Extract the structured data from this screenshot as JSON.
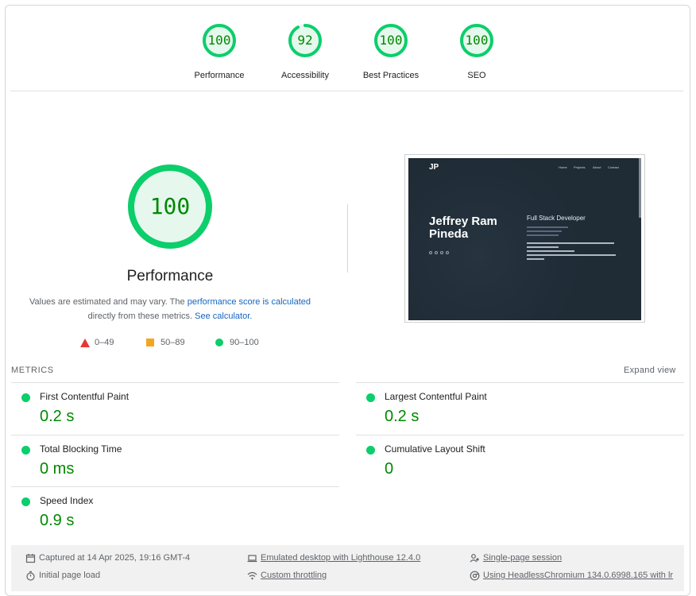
{
  "colors": {
    "pass": "#0cce6b",
    "pass_text": "#008800",
    "average": "#f4a520",
    "fail": "#e53935",
    "link": "#1565c0"
  },
  "categories": [
    {
      "label": "Performance",
      "score": "100",
      "fraction": 1.0
    },
    {
      "label": "Accessibility",
      "score": "92",
      "fraction": 0.92
    },
    {
      "label": "Best Practices",
      "score": "100",
      "fraction": 1.0
    },
    {
      "label": "SEO",
      "score": "100",
      "fraction": 1.0
    }
  ],
  "performance": {
    "score": "100",
    "fraction": 1.0,
    "title": "Performance",
    "desc_prefix": "Values are estimated and may vary. The ",
    "desc_link": "performance score is calculated",
    "desc_mid": " directly from these metrics. ",
    "desc_calc": "See calculator."
  },
  "legend": [
    {
      "icon": "fail-triangle-icon",
      "label": "0–49"
    },
    {
      "icon": "average-square-icon",
      "label": "50–89"
    },
    {
      "icon": "pass-circle-icon",
      "label": "90–100"
    }
  ],
  "preview": {
    "logo": "JP",
    "nav": [
      "Home",
      "Projects",
      "About",
      "Contact"
    ],
    "name": "Jeffrey Ram Pineda",
    "role": "Full Stack Developer"
  },
  "metrics": {
    "header": "METRICS",
    "expand": "Expand view",
    "items": [
      {
        "title": "First Contentful Paint",
        "value": "0.2 s"
      },
      {
        "title": "Largest Contentful Paint",
        "value": "0.2 s"
      },
      {
        "title": "Total Blocking Time",
        "value": "0 ms"
      },
      {
        "title": "Cumulative Layout Shift",
        "value": "0"
      },
      {
        "title": "Speed Index",
        "value": "0.9 s"
      }
    ]
  },
  "footer": {
    "captured": "Captured at 14 Apr 2025, 19:16 GMT-4",
    "emulated": "Emulated desktop with Lighthouse 12.4.0",
    "session": "Single-page session",
    "initial": "Initial page load",
    "throttling": "Custom throttling",
    "browser": "Using HeadlessChromium 134.0.6998.165 with lr"
  }
}
